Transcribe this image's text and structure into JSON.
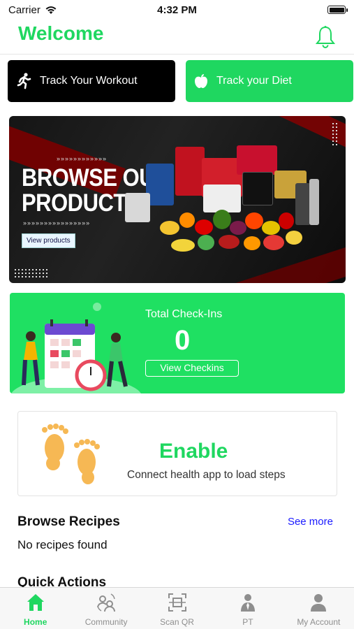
{
  "status_bar": {
    "carrier": "Carrier",
    "time": "4:32 PM"
  },
  "header": {
    "title": "Welcome"
  },
  "track": {
    "workout_label": "Track Your Workout",
    "diet_label": "Track your Diet"
  },
  "banner": {
    "line1": "BROWSE OUR",
    "line2": "PRODUCTS",
    "button": "View products"
  },
  "checkins": {
    "title": "Total Check-Ins",
    "count": "0",
    "button": "View Checkins"
  },
  "steps": {
    "title": "Enable",
    "subtitle": "Connect health app to load steps"
  },
  "recipes": {
    "heading": "Browse Recipes",
    "see_more": "See more",
    "empty": "No recipes found"
  },
  "quick_actions": {
    "heading": "Quick Actions"
  },
  "tabs": [
    {
      "label": "Home",
      "icon": "home-icon"
    },
    {
      "label": "Community",
      "icon": "community-icon"
    },
    {
      "label": "Scan QR",
      "icon": "scan-qr-icon"
    },
    {
      "label": "PT",
      "icon": "personal-trainer-icon"
    },
    {
      "label": "My Account",
      "icon": "account-icon"
    }
  ],
  "colors": {
    "accent": "#1fd760",
    "dark": "#000000",
    "link": "#1a1aff"
  }
}
